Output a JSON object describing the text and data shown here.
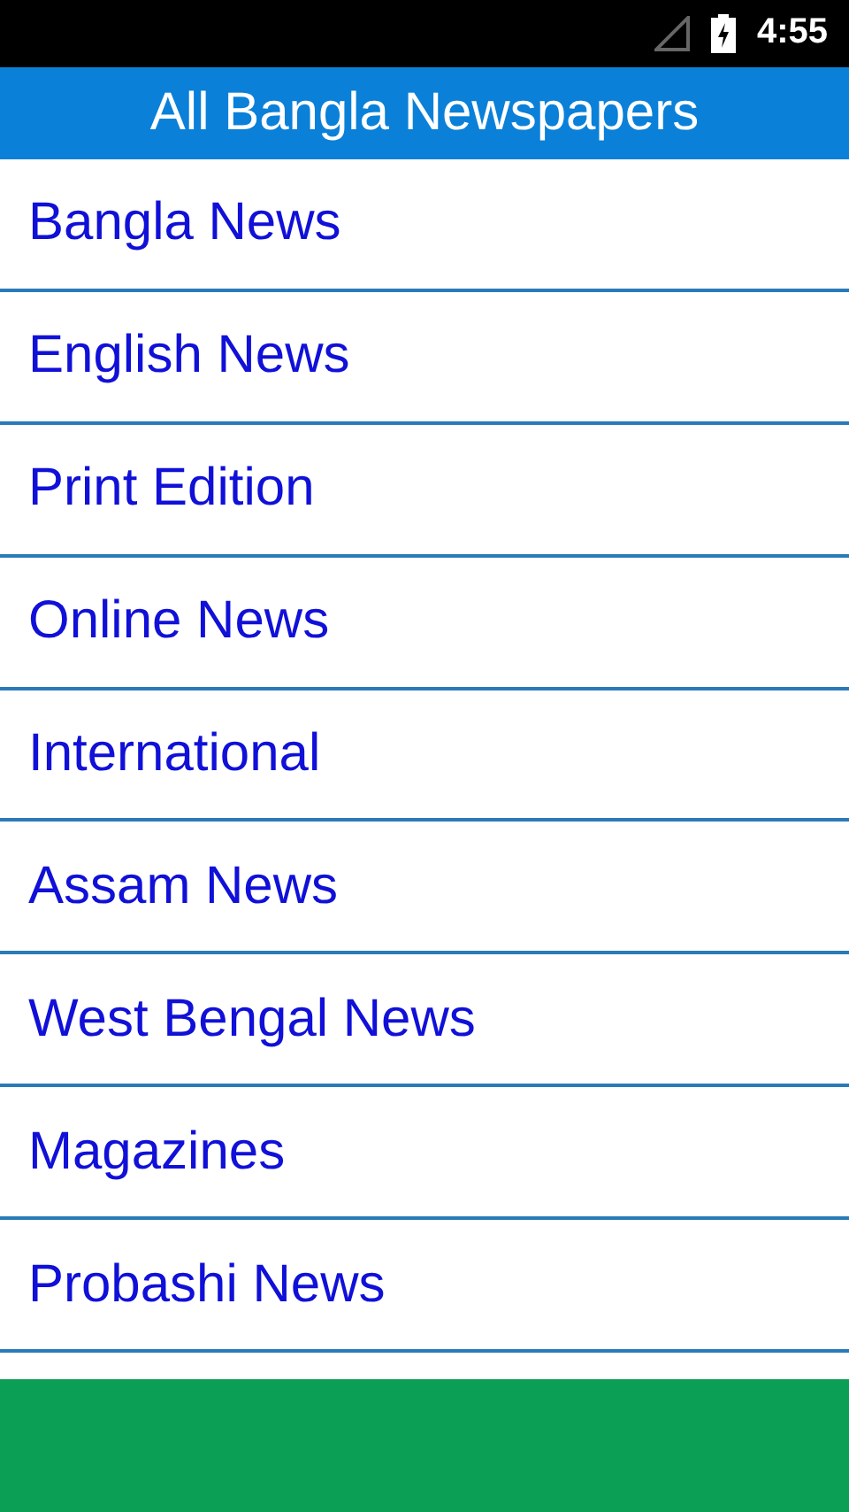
{
  "status_bar": {
    "time": "4:55"
  },
  "app_bar": {
    "title": "All Bangla Newspapers"
  },
  "menu": [
    {
      "label": "Bangla News"
    },
    {
      "label": "English News"
    },
    {
      "label": "Print Edition"
    },
    {
      "label": "Online News"
    },
    {
      "label": "International"
    },
    {
      "label": "Assam News"
    },
    {
      "label": "West Bengal News"
    },
    {
      "label": "Magazines"
    },
    {
      "label": "Probashi News"
    }
  ],
  "banner": {
    "kind": "ad"
  }
}
